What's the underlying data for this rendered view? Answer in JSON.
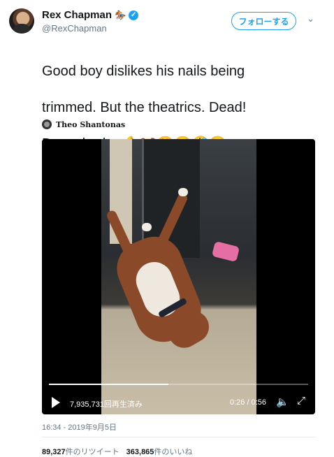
{
  "author": {
    "display_name": "Rex Chapman",
    "name_emoji": "🏇",
    "handle": "@RexChapman"
  },
  "follow_button": {
    "label": "フォローする"
  },
  "tweet": {
    "line1": "Good boy dislikes his nails being",
    "line2": "trimmed. But the theatrics. Dead!",
    "line3": "Dogs, bruh...💪🐶😍😂🤣😭"
  },
  "attribution": {
    "name": "Theo Shantonas"
  },
  "video": {
    "views_label": "7,935,731回再生済み",
    "time_label": "0:26 / 0:56",
    "progress": 0.46
  },
  "timestamp": "16:34 - 2019年9月5日",
  "stats": {
    "retweets_count": "89,327",
    "retweets_label": "件のリツイート",
    "likes_count": "363,865",
    "likes_label": "件のいいね"
  }
}
